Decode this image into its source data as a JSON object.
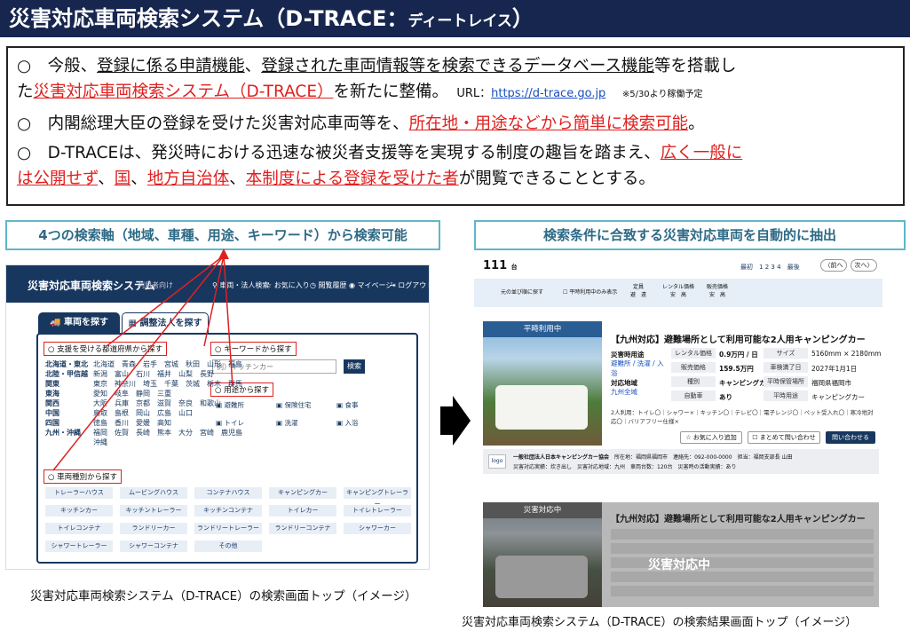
{
  "title": {
    "main": "災害対応車両検索システム（D-TRACE：",
    "kana": "ディートレイス",
    "close": "）"
  },
  "summary": {
    "b1": "○　今般、",
    "b1_u1": "登録に係る申請機能",
    "b1_s1": "、",
    "b1_u2": "登録された車両情報等を検索できるデータベース機能",
    "b1_s2": "等を搭載し",
    "b1_l2_a": "た",
    "b1_red": "災害対応車両検索システム（D-TRACE）",
    "b1_l2_b": "を新たに整備。",
    "url_label": "URL：",
    "url": "https://d-trace.go.jp",
    "url_note": "※5/30より稼働予定",
    "b2": "○　内閣総理大臣の登録を受けた災害対応車両等を、",
    "b2_red": "所在地・用途などから簡単に検索可能",
    "b2_end": "。",
    "b3": "○　D-TRACEは、発災時における迅速な被災者支援等を実現する制度の趣旨を踏まえ、",
    "b3_red1": "広く一般に",
    "b3_red1b": "は公開せず",
    "b3_s1": "、",
    "b3_red2": "国",
    "b3_s2": "、",
    "b3_red3": "地方自治体",
    "b3_s3": "、",
    "b3_red4": "本制度による登録を受けた者",
    "b3_end": "が閲覧できることとする。"
  },
  "left_label": "4つの検索軸（地域、車種、用途、キーワード）から検索可能",
  "right_label": "検索条件に合致する災害対応車両を自動的に抽出",
  "left_screen": {
    "title": "災害対応車両検索システム",
    "sub": "利用者向け",
    "nav": [
      "車両・法人検索",
      "お気に入り",
      "閲覧履歴",
      "マイページ",
      "ログアウト"
    ],
    "tab1": "車両を探す",
    "tab2": "調整法人を探す",
    "sec_region": "支援を受ける都道府県から探す",
    "sec_keyword": "キーワードから探す",
    "keyword_placeholder": "例）キッチンカー",
    "search_btn": "検索",
    "sec_use": "用途から探す",
    "sec_type": "車両種別から探す",
    "regions": [
      {
        "name": "北海道・東北",
        "prefs": "北海道　青森　岩手　宮城　秋田　山形　福島"
      },
      {
        "name": "北陸・甲信越",
        "prefs": "新潟　富山　石川　福井　山梨　長野"
      },
      {
        "name": "関東",
        "prefs": "東京　神奈川　埼玉　千葉　茨城　栃木　群馬"
      },
      {
        "name": "東海",
        "prefs": "愛知　岐阜　静岡　三重"
      },
      {
        "name": "関西",
        "prefs": "大阪　兵庫　京都　滋賀　奈良　和歌山"
      },
      {
        "name": "中国",
        "prefs": "鳥取　島根　岡山　広島　山口"
      },
      {
        "name": "四国",
        "prefs": "徳島　香川　愛媛　高知"
      },
      {
        "name": "九州・沖縄",
        "prefs": "福岡　佐賀　長崎　熊本　大分　宮崎　鹿児島"
      },
      {
        "name": "",
        "prefs": "沖縄"
      }
    ],
    "uses": [
      "避難所",
      "保険住宅",
      "食事",
      "トイレ",
      "洗濯",
      "入浴"
    ],
    "types": [
      "トレーラーハウス",
      "ムービングハウス",
      "コンテナハウス",
      "キャンピングカー",
      "キャンピングトレーラー",
      "キッチンカー",
      "キッチントレーラー",
      "キッチンコンテナ",
      "トイレカー",
      "トイレトレーラー",
      "トイレコンテナ",
      "ランドリーカー",
      "ランドリートレーラー",
      "ランドリーコンテナ",
      "シャワーカー",
      "シャワートレーラー",
      "シャワーコンテナ",
      "その他"
    ]
  },
  "left_caption": "災害対応車両検索システム（D-TRACE）の検索画面トップ（イメージ）",
  "right_screen": {
    "count": "111",
    "count_unit": "台",
    "pager_first": "最初",
    "pages": [
      "1",
      "2",
      "3",
      "4"
    ],
    "pager_last": "最後",
    "prev": "〈前へ",
    "next": "次へ〉",
    "filter_left": "元の並び順に探す",
    "filter_check": "平時利用中のみ表示",
    "cols": [
      {
        "h": "定員",
        "v": "避　遠"
      },
      {
        "h": "レンタル価格",
        "v": "安　高"
      },
      {
        "h": "販売価格",
        "v": "安　高"
      }
    ],
    "card1": {
      "badge": "平時利用中",
      "title": "【九州対応】避難場所として利用可能な2人用キャンピングカー",
      "use_h": "災害時用途",
      "use_v": "避難所 / 洗濯 / 入浴",
      "area_h": "対応地域",
      "area_v": "九州全域",
      "rental_h": "レンタル価格",
      "rental_v": "0.9万円 / 日",
      "sale_h": "販売価格",
      "sale_v": "159.5万円",
      "type_h": "種別",
      "type_v": "キャンピングカー",
      "self_h": "自動車",
      "self_v": "あり",
      "size_h": "サイズ",
      "size_v": "5160mm × 2180mm",
      "year_h": "車検満了日",
      "year_v": "2027年1月1日",
      "loc_h": "平時保管場所",
      "loc_v": "福岡県福岡市",
      "run_h": "平時用途",
      "run_v": "キャンピングカー",
      "equip": "2人利用：トイレ〇｜シャワー×｜キッチン〇｜テレビ〇｜電子レンジ〇｜ペット受入れ〇｜寒冷地対応〇｜バリアフリー仕様×",
      "fav": "お気に入り追加",
      "bulk": "まとめて問い合わせ",
      "ask": "問い合わせる"
    },
    "org": {
      "logo": "logo",
      "name": "一般社団法人日本キャンピングカー協会",
      "addr": "所在地：福岡県福岡市",
      "tel": "連絡先：092-000-0000",
      "rep": "担当：福岡支部長 山田",
      "l2": "災害対応実績：炊き出し　災害対応地域：九州　車両台数：120台　災害時の活動実績：あり"
    },
    "card2": {
      "badge": "災害対応中",
      "title": "【九州対応】避難場所として利用可能な2人用キャンピングカー",
      "overlay": "災害対応中"
    }
  },
  "right_caption": "災害対応車両検索システム（D-TRACE）の検索結果画面トップ（イメージ）"
}
